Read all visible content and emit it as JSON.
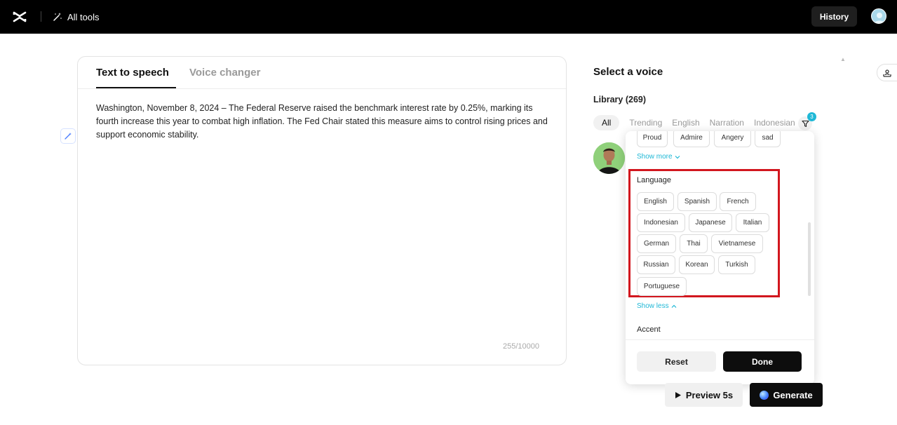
{
  "topbar": {
    "all_tools": "All tools",
    "history": "History"
  },
  "editor": {
    "tabs": [
      "Text to speech",
      "Voice changer"
    ],
    "text": "Washington, November 8, 2024 – The Federal Reserve raised the benchmark interest rate by 0.25%, marking its fourth increase this year to combat high inflation. The Fed Chair stated this measure aims to control rising prices and support economic stability.",
    "char_count": "255/10000"
  },
  "voice_panel": {
    "title": "Select a voice",
    "library": "Library (269)",
    "chips": [
      "All",
      "Trending",
      "English",
      "Narration",
      "Indonesian"
    ],
    "filter_badge": "3"
  },
  "filter": {
    "emotion_tags": [
      "Proud",
      "Admire",
      "Angery",
      "sad"
    ],
    "show_more": "Show more",
    "language_label": "Language",
    "languages": [
      "English",
      "Spanish",
      "French",
      "Indonesian",
      "Japanese",
      "Italian",
      "German",
      "Thai",
      "Vietnamese",
      "Russian",
      "Korean",
      "Turkish",
      "Portuguese"
    ],
    "show_less": "Show less",
    "accent_label": "Accent",
    "reset": "Reset",
    "done": "Done"
  },
  "actions": {
    "preview": "Preview 5s",
    "generate": "Generate"
  },
  "colors": {
    "accent": "#1fb8d6",
    "highlight": "#d2161e"
  }
}
